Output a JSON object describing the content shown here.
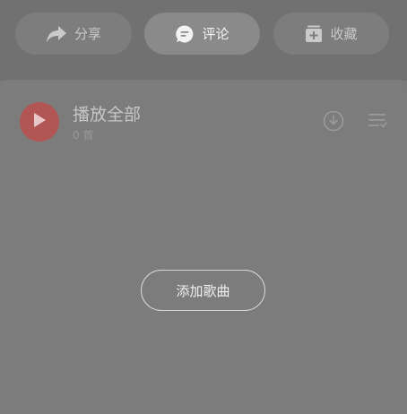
{
  "actions": {
    "share_label": "分享",
    "comment_label": "评论",
    "collect_label": "收藏"
  },
  "playlist": {
    "play_all_label": "播放全部",
    "song_count": "0 首",
    "add_song_label": "添加歌曲"
  },
  "icons": {
    "share": "share-arrow-icon",
    "comment": "comment-bubble-icon",
    "collect": "add-to-collection-icon",
    "play": "play-icon",
    "download": "download-icon",
    "multi_select": "list-multi-select-icon"
  },
  "colors": {
    "play_button": "#b25555",
    "active_text": "#f3f3f3",
    "inactive_text": "#c9c9c9"
  }
}
